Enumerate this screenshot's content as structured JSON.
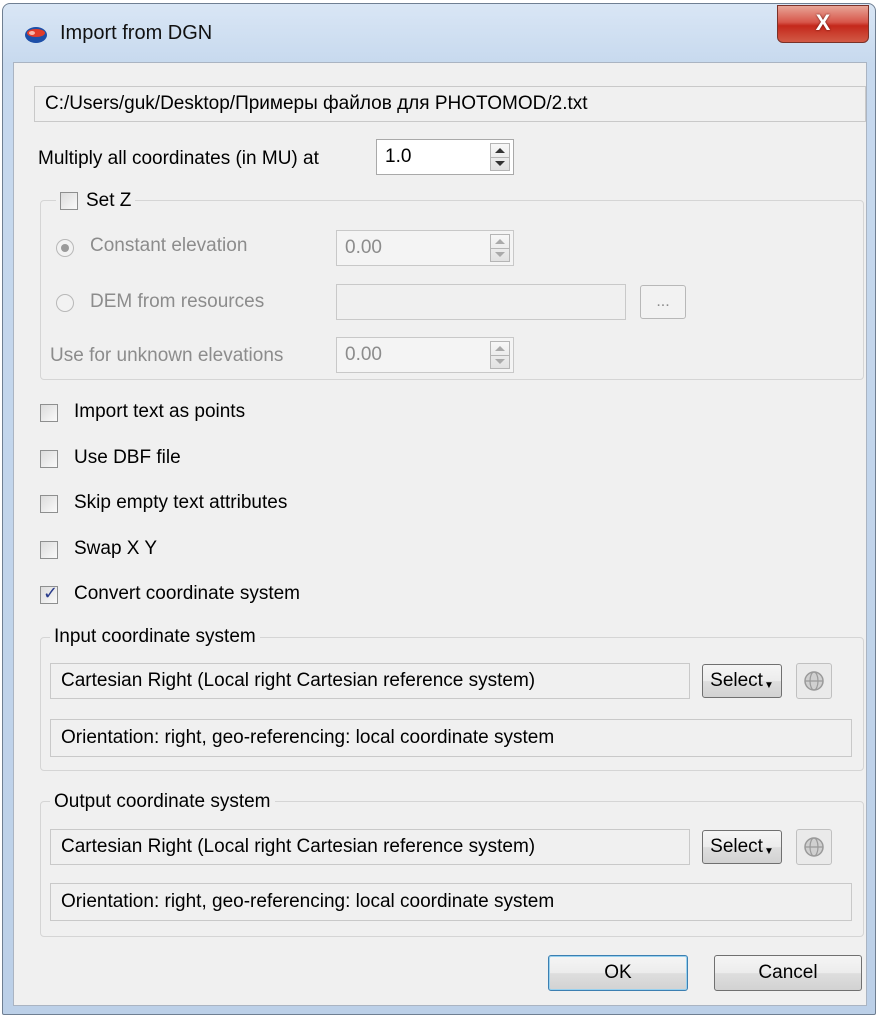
{
  "window": {
    "title": "Import from DGN",
    "close_label": "X"
  },
  "file_path": "C:/Users/guk/Desktop/Примеры файлов для PHOTOMOD/2.txt",
  "multiply": {
    "label": "Multiply all coordinates (in MU) at",
    "value": "1.0"
  },
  "set_z": {
    "label": "Set Z",
    "checked": false,
    "constant_elevation": {
      "label": "Constant elevation",
      "value": "0.00",
      "selected": true
    },
    "dem_from_resources": {
      "label": "DEM from resources",
      "value": "",
      "browse_label": "..."
    },
    "unknown_elevations": {
      "label": "Use for unknown elevations",
      "value": "0.00"
    }
  },
  "options": [
    {
      "label": "Import text as points",
      "checked": false
    },
    {
      "label": "Use DBF file",
      "checked": false
    },
    {
      "label": "Skip empty text attributes",
      "checked": false
    },
    {
      "label": "Swap X Y",
      "checked": false
    },
    {
      "label": "Convert coordinate system",
      "checked": true
    }
  ],
  "input_cs": {
    "legend": "Input coordinate system",
    "name": "Cartesian Right (Local right Cartesian reference system)",
    "orientation": "Orientation: right, geo-referencing: local coordinate system",
    "select_label": "Select",
    "globe_icon": "globe-icon"
  },
  "output_cs": {
    "legend": "Output coordinate system",
    "name": "Cartesian Right (Local right Cartesian reference system)",
    "orientation": "Orientation: right, geo-referencing: local coordinate system",
    "select_label": "Select",
    "globe_icon": "globe-icon"
  },
  "buttons": {
    "ok": "OK",
    "cancel": "Cancel"
  }
}
